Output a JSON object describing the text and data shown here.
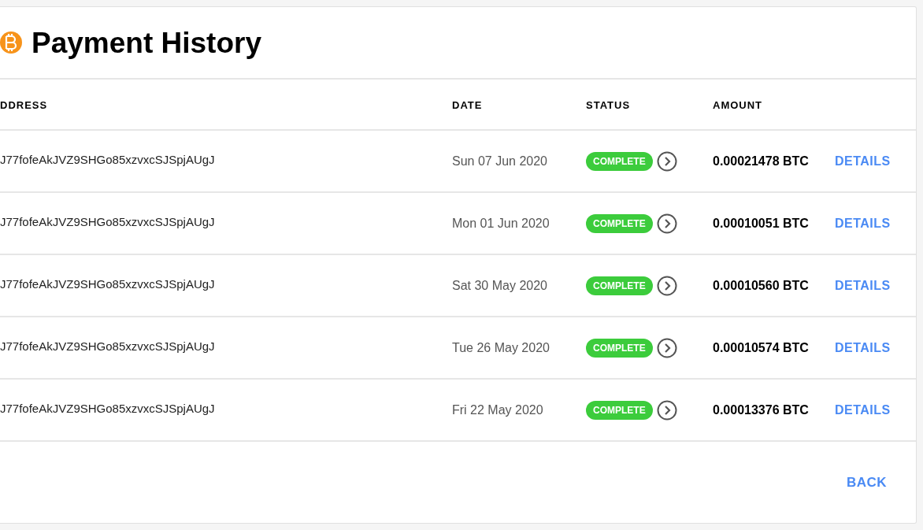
{
  "title": "Payment History",
  "table": {
    "columns": [
      "DDRESS",
      "DATE",
      "STATUS",
      "AMOUNT"
    ],
    "rows": [
      {
        "address": "J77fofeAkJVZ9SHGo85xzvxcSJSpjAUgJ",
        "date": "Sun 07 Jun 2020",
        "status": "COMPLETE",
        "amount": "0.00021478 BTC",
        "action": "DETAILS"
      },
      {
        "address": "J77fofeAkJVZ9SHGo85xzvxcSJSpjAUgJ",
        "date": "Mon 01 Jun 2020",
        "status": "COMPLETE",
        "amount": "0.00010051 BTC",
        "action": "DETAILS"
      },
      {
        "address": "J77fofeAkJVZ9SHGo85xzvxcSJSpjAUgJ",
        "date": "Sat 30 May 2020",
        "status": "COMPLETE",
        "amount": "0.00010560 BTC",
        "action": "DETAILS"
      },
      {
        "address": "J77fofeAkJVZ9SHGo85xzvxcSJSpjAUgJ",
        "date": "Tue 26 May 2020",
        "status": "COMPLETE",
        "amount": "0.00010574 BTC",
        "action": "DETAILS"
      },
      {
        "address": "J77fofeAkJVZ9SHGo85xzvxcSJSpjAUgJ",
        "date": "Fri 22 May 2020",
        "status": "COMPLETE",
        "amount": "0.00013376 BTC",
        "action": "DETAILS"
      }
    ]
  },
  "back_button": "BACK"
}
